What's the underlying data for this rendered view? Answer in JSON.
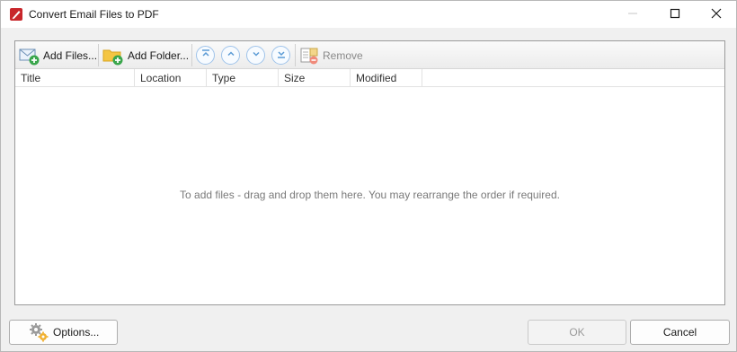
{
  "window": {
    "title": "Convert Email Files to PDF"
  },
  "toolbar": {
    "add_files_label": "Add Files...",
    "add_files_accel": "A",
    "add_folder_label": "Add Folder...",
    "add_folder_accel": "F",
    "remove_label": "Remove",
    "remove_accel": "R"
  },
  "columns": [
    "Title",
    "Location",
    "Type",
    "Size",
    "Modified"
  ],
  "empty_message": "To add files - drag and drop them here. You may rearrange the order if required.",
  "footer": {
    "options_label": "Options...",
    "ok_label": "OK",
    "cancel_label": "Cancel"
  },
  "icons": {
    "app": "pdf-pen-icon",
    "add_files": "email-add-icon",
    "add_folder": "folder-add-icon",
    "move_top": "move-to-top-icon",
    "move_up": "move-up-icon",
    "move_down": "move-down-icon",
    "move_bottom": "move-to-bottom-icon",
    "remove": "remove-list-icon",
    "options": "gears-icon"
  },
  "colors": {
    "accent_red": "#c8262b",
    "arrow_blue": "#5b9bd5",
    "folder_yellow": "#f4c542",
    "add_green": "#3aa64c"
  }
}
